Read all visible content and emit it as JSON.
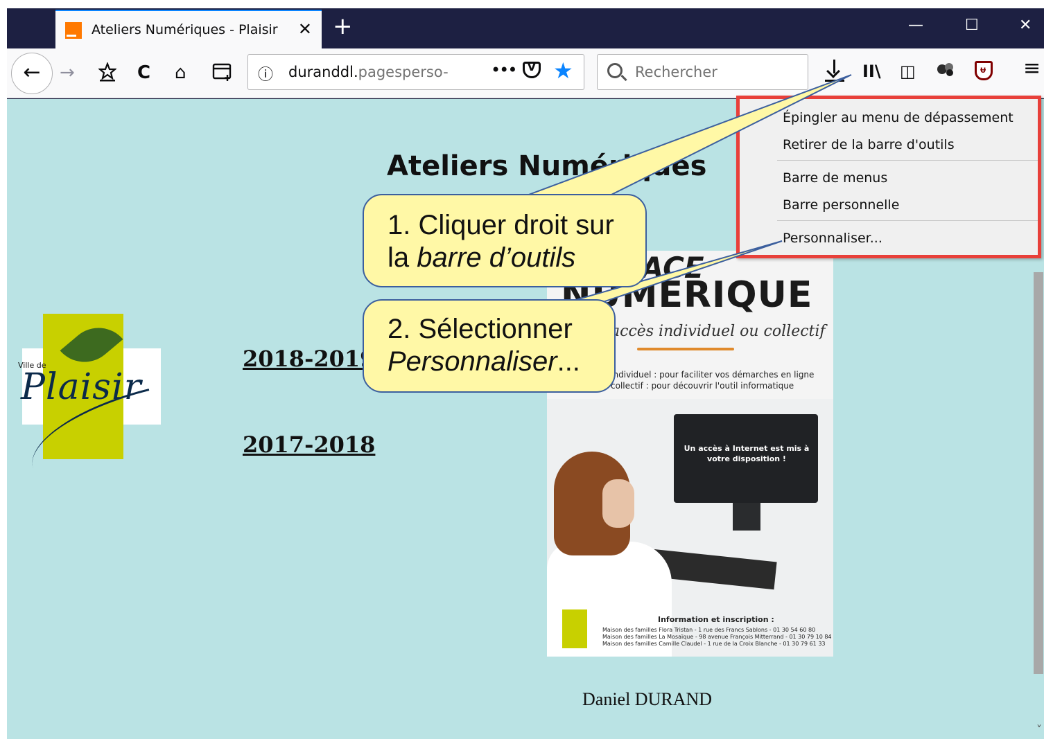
{
  "browser": {
    "tab_title": "Ateliers Numériques - Plaisir",
    "tab_close": "✕",
    "new_tab": "+",
    "minimize": "—",
    "maximize": "☐",
    "close": "✕",
    "url_info_icon": "ⓘ",
    "url_host": "duranddl.",
    "url_rest": "pagesperso-",
    "url_more": "•••",
    "search_placeholder": "Rechercher",
    "back_icon": "←",
    "forward_icon": "→",
    "reload_icon": "C",
    "home_icon": "⌂",
    "library_icon": "II\\",
    "sidebar_icon": "◫",
    "menu_icon": "≡",
    "bookmark_star": "★"
  },
  "page": {
    "title": "Ateliers Numériques",
    "links": [
      "2018-2019",
      "2017-2018"
    ],
    "author": "Daniel DURAND",
    "logo_small": "Ville de",
    "logo_name": "Plaisir"
  },
  "poster": {
    "espace": "ESPACE",
    "numerique": "NUMÉRIQUE",
    "tagline": "accès individuel ou collectif",
    "line1": "Individuel : pour faciliter vos démarches en ligne",
    "line2": "collectif : pour découvrir l'outil informatique",
    "screen_text": "Un accès à Internet est mis à votre disposition !",
    "info_title": "Information et inscription :",
    "info_lines": [
      "Maison des familles Flora Tristan - 1 rue des Francs Sablons - 01 30 54 60 80",
      "Maison des familles La Mosaïque - 98 avenue François Mitterrand - 01 30 79 10 84",
      "Maison des familles Camille Claudel - 1 rue de la Croix Blanche - 01 30 79 61 33"
    ]
  },
  "context_menu": {
    "items": [
      "Épingler au menu de dépassement",
      "Retirer de la barre d'outils",
      "Barre de menus",
      "Barre personnelle",
      "Personnaliser..."
    ]
  },
  "callouts": {
    "step1_line1": "1. Cliquer droit sur",
    "step1_line2_prefix": "la ",
    "step1_line2_em": "barre d’outils",
    "step2_line1": "2. Sélectionner",
    "step2_line2_em": "Personnaliser",
    "step2_line2_suffix": "..."
  },
  "colors": {
    "page_background": "#bae3e4",
    "titlebar": "#1d2042",
    "highlight_border": "#e8403a",
    "callout_fill": "#fff8a6",
    "accent": "#0a84ff"
  }
}
